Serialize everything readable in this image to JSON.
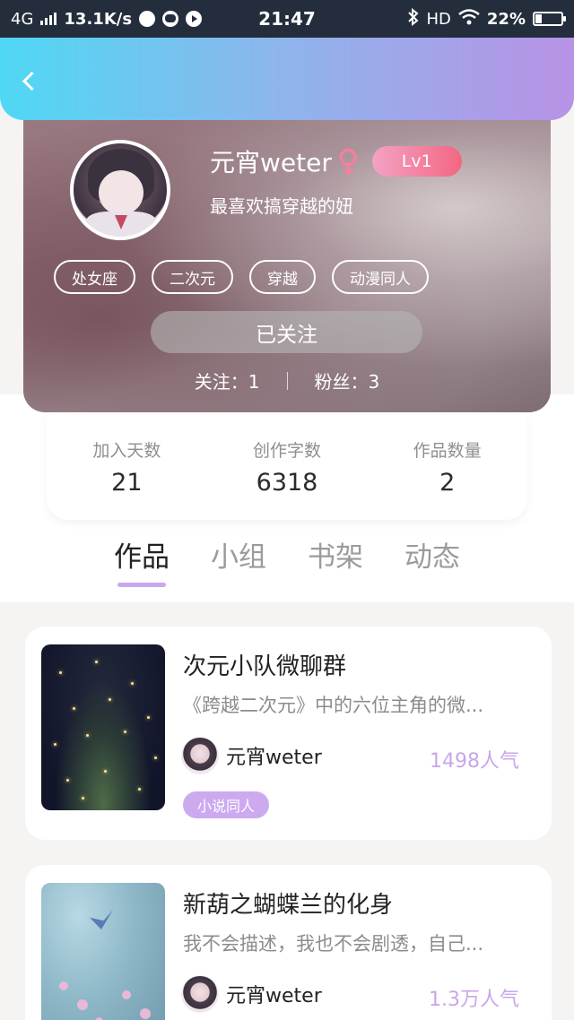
{
  "status_bar": {
    "network": "4G",
    "speed": "13.1K/s",
    "time": "21:47",
    "hd": "HD",
    "battery": "22%",
    "icons": [
      "signal-icon",
      "browser-icon",
      "message-icon",
      "play-icon",
      "bluetooth-icon",
      "wifi-icon",
      "battery-icon"
    ]
  },
  "header": {
    "back_icon": "chevron-left-icon"
  },
  "profile": {
    "username": "元宵weter",
    "gender_symbol": "♀",
    "level": "Lv1",
    "bio": "最喜欢搞穿越的妞",
    "tags": [
      "处女座",
      "二次元",
      "穿越",
      "动漫同人"
    ],
    "follow_button": "已关注",
    "following": "关注：1",
    "followers": "粉丝：3"
  },
  "stats": [
    {
      "label": "加入天数",
      "value": "21"
    },
    {
      "label": "创作字数",
      "value": "6318"
    },
    {
      "label": "作品数量",
      "value": "2"
    }
  ],
  "tabs": [
    "作品",
    "小组",
    "书架",
    "动态"
  ],
  "active_tab": "作品",
  "works": [
    {
      "title": "次元小队微聊群",
      "desc": "《跨越二次元》中的六位主角的微...",
      "author": "元宵weter",
      "popularity": "1498人气",
      "tag": "小说同人"
    },
    {
      "title": "新葫之蝴蝶兰的化身",
      "desc": "我不会描述，我也不会剧透，自己...",
      "author": "元宵weter",
      "popularity": "1.3万人气"
    }
  ],
  "colors": {
    "accent": "#cdaaf0",
    "gradient_start": "#4fd8f4",
    "gradient_end": "#b892e6",
    "status_bar": "#232d3c"
  }
}
